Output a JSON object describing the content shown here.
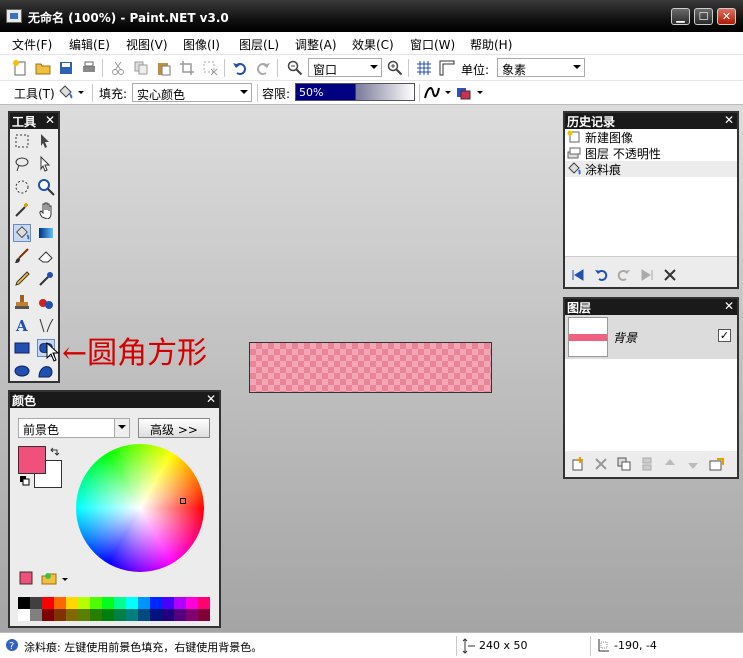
{
  "window": {
    "title": "无命名 (100%) - Paint.NET v3.0"
  },
  "menu": [
    "文件(F)",
    "编辑(E)",
    "视图(V)",
    "图像(I)",
    "图层(L)",
    "调整(A)",
    "效果(C)",
    "窗口(W)",
    "帮助(H)"
  ],
  "toolbar1": {
    "zoom_value": "窗口",
    "units_label": "单位:",
    "units_value": "象素"
  },
  "toolbar2": {
    "tool_label": "工具(T)",
    "fill_label": "填充:",
    "fill_value": "实心颜色",
    "tolerance_label": "容限:",
    "tolerance_value": "50%"
  },
  "tools_panel": {
    "title": "工具",
    "close": "✕"
  },
  "annotation": {
    "arrow": "←",
    "text": "圆角方形"
  },
  "history_panel": {
    "title": "历史记录",
    "close": "✕",
    "items": [
      {
        "label": "新建图像",
        "icon": "new-image-icon"
      },
      {
        "label": "图层 不透明性",
        "icon": "layer-opacity-icon"
      },
      {
        "label": "涂料痕",
        "icon": "paint-bucket-icon"
      }
    ]
  },
  "layers_panel": {
    "title": "图层",
    "close": "✕",
    "layer_name": "背景",
    "checked": "✓"
  },
  "colors_panel": {
    "title": "颜色",
    "close": "✕",
    "mode": "前景色",
    "advanced_button": "高级 >>",
    "primary_color": "#f0507a",
    "secondary_color": "#ffffff",
    "palette_row1": [
      "#000000",
      "#404040",
      "#ff0000",
      "#ff6a00",
      "#ffd800",
      "#b6ff00",
      "#4cff00",
      "#00ff21",
      "#00ff90",
      "#00ffff",
      "#0094ff",
      "#0026ff",
      "#4800ff",
      "#b200ff",
      "#ff00dc",
      "#ff006e"
    ],
    "palette_row2": [
      "#ffffff",
      "#808080",
      "#7f0000",
      "#7f3300",
      "#7f6a00",
      "#5b7f00",
      "#267f00",
      "#007f0e",
      "#007f46",
      "#007f7f",
      "#004a7f",
      "#00137f",
      "#21007f",
      "#57007f",
      "#7f006e",
      "#7f0037"
    ]
  },
  "status": {
    "hint": "涂料痕: 左键使用前景色填充，右键使用背景色。",
    "size": "240 x 50",
    "position": "-190, -4"
  }
}
